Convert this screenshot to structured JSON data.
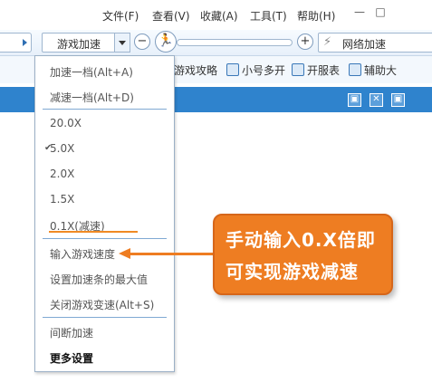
{
  "menubar": {
    "items": [
      "文件(F)",
      "查看(V)",
      "收藏(A)",
      "工具(T)",
      "帮助(H)"
    ],
    "minimize": "—",
    "maximize": "□"
  },
  "toolbar": {
    "speed_select_label": "游戏加速",
    "minus": "−",
    "plus": "+",
    "runner": "🏃",
    "network_label": "网络加速",
    "network_icon": "⚡"
  },
  "toolbar2": {
    "items": [
      "游戏攻略",
      "小号多开",
      "开服表",
      "辅助大"
    ]
  },
  "titlebar_controls": [
    "▣",
    "✕",
    "▣"
  ],
  "dropdown": {
    "items": [
      "加速一档(Alt+A)",
      "减速一档(Alt+D)",
      "20.0X",
      "5.0X",
      "2.0X",
      "1.5X",
      "0.1X(减速)",
      "输入游戏速度",
      "设置加速条的最大值",
      "关闭游戏变速(Alt+S)",
      "间断加速",
      "更多设置"
    ],
    "checkmark": "✔",
    "checked_item": "5.0X"
  },
  "callout": {
    "line1": "手动输入0.X倍即",
    "line2": "可实现游戏减速"
  },
  "colors": {
    "accent": "#2f83cd",
    "callout": "#ee7d22"
  }
}
